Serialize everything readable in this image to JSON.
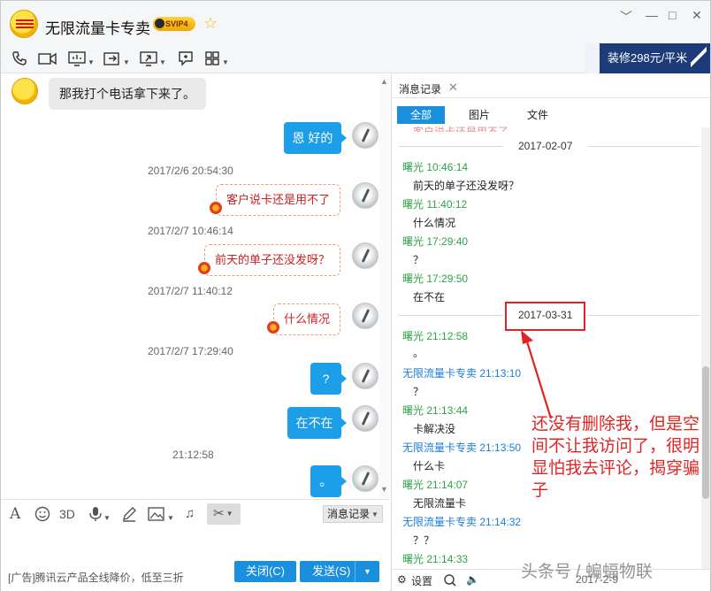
{
  "window": {
    "title": "无限流量卡专卖",
    "badge": "SVIP",
    "badge_level": "4",
    "controls": [
      "﹀",
      "—",
      "□",
      "✕"
    ]
  },
  "toolbar": {
    "icons": [
      "phone-icon",
      "video-icon",
      "screen-share-icon",
      "file-transfer-icon",
      "remote-desktop-icon",
      "chat-icon",
      "apps-icon"
    ],
    "ad_banner": "装修298元/平米"
  },
  "chat": {
    "messages": [
      {
        "side": "left",
        "text": "那我打个电话拿下来了。"
      },
      {
        "side": "right",
        "style": "blue",
        "text": "恩 好的"
      },
      {
        "type": "timestamp",
        "text": "2017/2/6 20:54:30"
      },
      {
        "side": "right",
        "style": "red",
        "text": "客户说卡还是用不了"
      },
      {
        "type": "timestamp",
        "text": "2017/2/7 10:46:14"
      },
      {
        "side": "right",
        "style": "red",
        "text": "前天的单子还没发呀？"
      },
      {
        "type": "timestamp",
        "text": "2017/2/7 11:40:12"
      },
      {
        "side": "right",
        "style": "red",
        "text": "什么情况"
      },
      {
        "type": "timestamp",
        "text": "2017/2/7 17:29:40"
      },
      {
        "side": "right",
        "style": "blue",
        "text": "?"
      },
      {
        "side": "right",
        "style": "blue",
        "text": "在不在"
      },
      {
        "type": "timestamp",
        "text": "21:12:58"
      },
      {
        "side": "right",
        "style": "blue",
        "text": "。"
      }
    ]
  },
  "input_tools": {
    "icons": [
      "font-icon",
      "emoji-icon",
      "3d-icon",
      "voice-icon",
      "pen-icon",
      "image-icon",
      "music-icon",
      "scissors-icon"
    ],
    "three_d_label": "3D",
    "history_button": "消息记录"
  },
  "bottom": {
    "ad": "[广告]腾讯云产品全线降价，低至三折",
    "close_button": "关闭(C)",
    "send_button": "发送(S)"
  },
  "history": {
    "tab_label": "消息记录",
    "filters": [
      "全部",
      "图片",
      "文件"
    ],
    "active_filter": "全部",
    "top_cut_text": "客户说卡还是用不了",
    "date1": "2017-02-07",
    "entries1": [
      {
        "name": "曙光",
        "time": "10:46:14",
        "text": "前天的单子还没发呀？",
        "color": "green"
      },
      {
        "name": "曙光",
        "time": "11:40:12",
        "text": "什么情况",
        "color": "green"
      },
      {
        "name": "曙光",
        "time": "17:29:40",
        "text": "？",
        "color": "green"
      },
      {
        "name": "曙光",
        "time": "17:29:50",
        "text": "在不在",
        "color": "green"
      }
    ],
    "date2": "2017-03-31",
    "entries2": [
      {
        "name": "曙光",
        "time": "21:12:58",
        "text": "。",
        "color": "green"
      },
      {
        "name": "无限流量卡专卖",
        "time": "21:13:10",
        "text": "？",
        "color": "blue"
      },
      {
        "name": "曙光",
        "time": "21:13:44",
        "text": "卡解决没",
        "color": "green"
      },
      {
        "name": "无限流量卡专卖",
        "time": "21:13:50",
        "text": "什么卡",
        "color": "blue"
      },
      {
        "name": "曙光",
        "time": "21:14:07",
        "text": "无限流量卡",
        "color": "green"
      },
      {
        "name": "无限流量卡专卖",
        "time": "21:14:32",
        "text": "？？",
        "color": "blue"
      },
      {
        "name": "曙光",
        "time": "21:14:33",
        "text": "",
        "color": "green"
      }
    ],
    "settings_label": "设置",
    "bottom_date": "2017-2-9"
  },
  "annotation": {
    "text": "还没有删除我，但是空间不让我访问了，很明显怕我去评论，揭穿骗子"
  },
  "watermark": "头条号 / 蝙蝠物联",
  "colors": {
    "accent_blue": "#1a8fdd",
    "bubble_blue": "#1d9ee8",
    "name_green": "#2fa347",
    "name_blue": "#1a7ed8",
    "annotation_red": "#e02424"
  }
}
